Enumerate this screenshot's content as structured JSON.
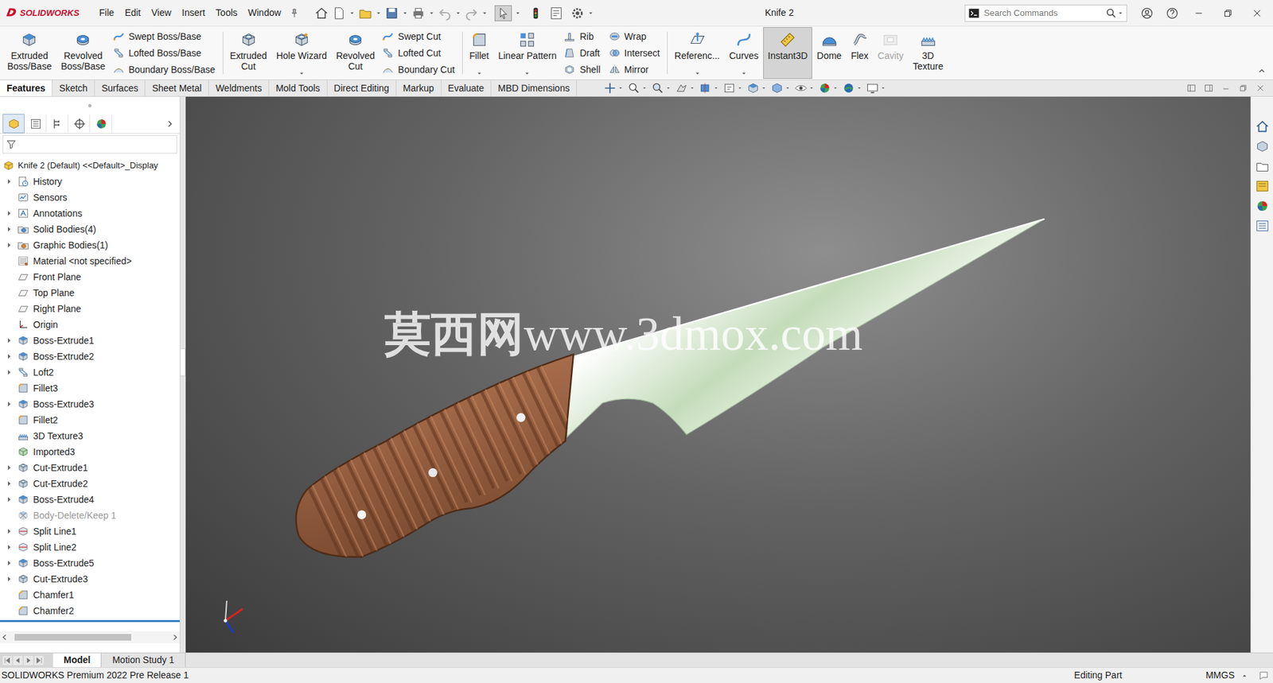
{
  "app": {
    "brand": "SOLIDWORKS"
  },
  "menu": [
    "File",
    "Edit",
    "View",
    "Insert",
    "Tools",
    "Window"
  ],
  "quick_access": {
    "select_active": true
  },
  "window": {
    "title": "Knife 2"
  },
  "search": {
    "placeholder": "Search Commands"
  },
  "ribbon": {
    "groups": [
      [
        {
          "kind": "big",
          "lines": [
            "Extruded",
            "Boss/Base"
          ],
          "dropdown": false,
          "selected": false,
          "disabled": false
        },
        {
          "kind": "big",
          "lines": [
            "Revolved",
            "Boss/Base"
          ],
          "dropdown": false,
          "selected": false,
          "disabled": false
        },
        {
          "kind": "stack",
          "items": [
            {
              "label": "Swept Boss/Base"
            },
            {
              "label": "Lofted Boss/Base"
            },
            {
              "label": "Boundary Boss/Base"
            }
          ]
        }
      ],
      [
        {
          "kind": "big",
          "lines": [
            "Extruded",
            "Cut"
          ],
          "dropdown": false,
          "selected": false,
          "disabled": false
        },
        {
          "kind": "big",
          "lines": [
            "Hole Wizard"
          ],
          "dropdown": true,
          "selected": false,
          "disabled": false
        },
        {
          "kind": "big",
          "lines": [
            "Revolved",
            "Cut"
          ],
          "dropdown": false,
          "selected": false,
          "disabled": false
        },
        {
          "kind": "stack",
          "items": [
            {
              "label": "Swept Cut"
            },
            {
              "label": "Lofted Cut"
            },
            {
              "label": "Boundary Cut"
            }
          ]
        }
      ],
      [
        {
          "kind": "big",
          "lines": [
            "Fillet"
          ],
          "dropdown": true,
          "selected": false,
          "disabled": false
        },
        {
          "kind": "big",
          "lines": [
            "Linear Pattern"
          ],
          "dropdown": true,
          "selected": false,
          "disabled": false
        },
        {
          "kind": "stack",
          "items": [
            {
              "label": "Rib"
            },
            {
              "label": "Draft"
            },
            {
              "label": "Shell"
            }
          ]
        },
        {
          "kind": "stack",
          "items": [
            {
              "label": "Wrap"
            },
            {
              "label": "Intersect"
            },
            {
              "label": "Mirror"
            }
          ]
        }
      ],
      [
        {
          "kind": "big",
          "lines": [
            "Referenc..."
          ],
          "dropdown": true,
          "selected": false,
          "disabled": false
        },
        {
          "kind": "big",
          "lines": [
            "Curves"
          ],
          "dropdown": true,
          "selected": false,
          "disabled": false
        },
        {
          "kind": "big",
          "lines": [
            "Instant3D"
          ],
          "dropdown": false,
          "selected": true,
          "disabled": false
        },
        {
          "kind": "big",
          "lines": [
            "Dome"
          ],
          "dropdown": false,
          "selected": false,
          "disabled": false
        },
        {
          "kind": "big",
          "lines": [
            "Flex"
          ],
          "dropdown": false,
          "selected": false,
          "disabled": false
        },
        {
          "kind": "big",
          "lines": [
            "Cavity"
          ],
          "dropdown": false,
          "selected": false,
          "disabled": true
        },
        {
          "kind": "big",
          "lines": [
            "3D",
            "Texture"
          ],
          "dropdown": false,
          "selected": false,
          "disabled": false
        }
      ]
    ]
  },
  "command_tabs": [
    {
      "label": "Features",
      "selected": true
    },
    {
      "label": "Sketch",
      "selected": false
    },
    {
      "label": "Surfaces",
      "selected": false
    },
    {
      "label": "Sheet Metal",
      "selected": false
    },
    {
      "label": "Weldments",
      "selected": false
    },
    {
      "label": "Mold Tools",
      "selected": false
    },
    {
      "label": "Direct Editing",
      "selected": false
    },
    {
      "label": "Markup",
      "selected": false
    },
    {
      "label": "Evaluate",
      "selected": false
    },
    {
      "label": "MBD Dimensions",
      "selected": false
    }
  ],
  "panel_tabs": [
    {
      "selected": true
    },
    {
      "selected": false
    },
    {
      "selected": false
    },
    {
      "selected": false
    },
    {
      "selected": false
    }
  ],
  "feature_tree": {
    "root": "Knife 2 (Default) <<Default>_Display",
    "items": [
      {
        "label": "History",
        "kind": "history",
        "expandable": true,
        "suppressed": false
      },
      {
        "label": "Sensors",
        "kind": "sensor",
        "expandable": false,
        "suppressed": false
      },
      {
        "label": "Annotations",
        "kind": "annotation",
        "expandable": true,
        "suppressed": false
      },
      {
        "label": "Solid Bodies(4)",
        "kind": "bodies",
        "expandable": true,
        "suppressed": false
      },
      {
        "label": "Graphic Bodies(1)",
        "kind": "graphic",
        "expandable": true,
        "suppressed": false
      },
      {
        "label": "Material <not specified>",
        "kind": "material",
        "expandable": false,
        "suppressed": false
      },
      {
        "label": "Front Plane",
        "kind": "plane",
        "expandable": false,
        "suppressed": false
      },
      {
        "label": "Top Plane",
        "kind": "plane",
        "expandable": false,
        "suppressed": false
      },
      {
        "label": "Right Plane",
        "kind": "plane",
        "expandable": false,
        "suppressed": false
      },
      {
        "label": "Origin",
        "kind": "origin",
        "expandable": false,
        "suppressed": false
      },
      {
        "label": "Boss-Extrude1",
        "kind": "extrude",
        "expandable": true,
        "suppressed": false
      },
      {
        "label": "Boss-Extrude2",
        "kind": "extrude",
        "expandable": true,
        "suppressed": false
      },
      {
        "label": "Loft2",
        "kind": "loft",
        "expandable": true,
        "suppressed": false
      },
      {
        "label": "Fillet3",
        "kind": "fillet",
        "expandable": false,
        "suppressed": false
      },
      {
        "label": "Boss-Extrude3",
        "kind": "extrude",
        "expandable": true,
        "suppressed": false
      },
      {
        "label": "Fillet2",
        "kind": "fillet",
        "expandable": false,
        "suppressed": false
      },
      {
        "label": "3D Texture3",
        "kind": "texture",
        "expandable": false,
        "suppressed": false
      },
      {
        "label": "Imported3",
        "kind": "imported",
        "expandable": false,
        "suppressed": false
      },
      {
        "label": "Cut-Extrude1",
        "kind": "cut",
        "expandable": true,
        "suppressed": false
      },
      {
        "label": "Cut-Extrude2",
        "kind": "cut",
        "expandable": true,
        "suppressed": false
      },
      {
        "label": "Boss-Extrude4",
        "kind": "extrude",
        "expandable": true,
        "suppressed": false
      },
      {
        "label": "Body-Delete/Keep 1",
        "kind": "delete",
        "expandable": false,
        "suppressed": true
      },
      {
        "label": "Split Line1",
        "kind": "split",
        "expandable": true,
        "suppressed": false
      },
      {
        "label": "Split Line2",
        "kind": "split",
        "expandable": true,
        "suppressed": false
      },
      {
        "label": "Boss-Extrude5",
        "kind": "extrude",
        "expandable": true,
        "suppressed": false
      },
      {
        "label": "Cut-Extrude3",
        "kind": "cut",
        "expandable": true,
        "suppressed": false
      },
      {
        "label": "Chamfer1",
        "kind": "chamfer",
        "expandable": false,
        "suppressed": false
      },
      {
        "label": "Chamfer2",
        "kind": "chamfer",
        "expandable": false,
        "suppressed": false
      }
    ]
  },
  "viewport": {
    "watermark": {
      "cjk": "莫西网",
      "latin": "www.3dmox.com"
    }
  },
  "bottom_tabs": [
    {
      "label": "Model",
      "selected": true
    },
    {
      "label": "Motion Study 1",
      "selected": false
    }
  ],
  "status_bar": {
    "product": "SOLIDWORKS Premium 2022 Pre Release 1",
    "mode": "Editing Part",
    "units": "MMGS"
  }
}
